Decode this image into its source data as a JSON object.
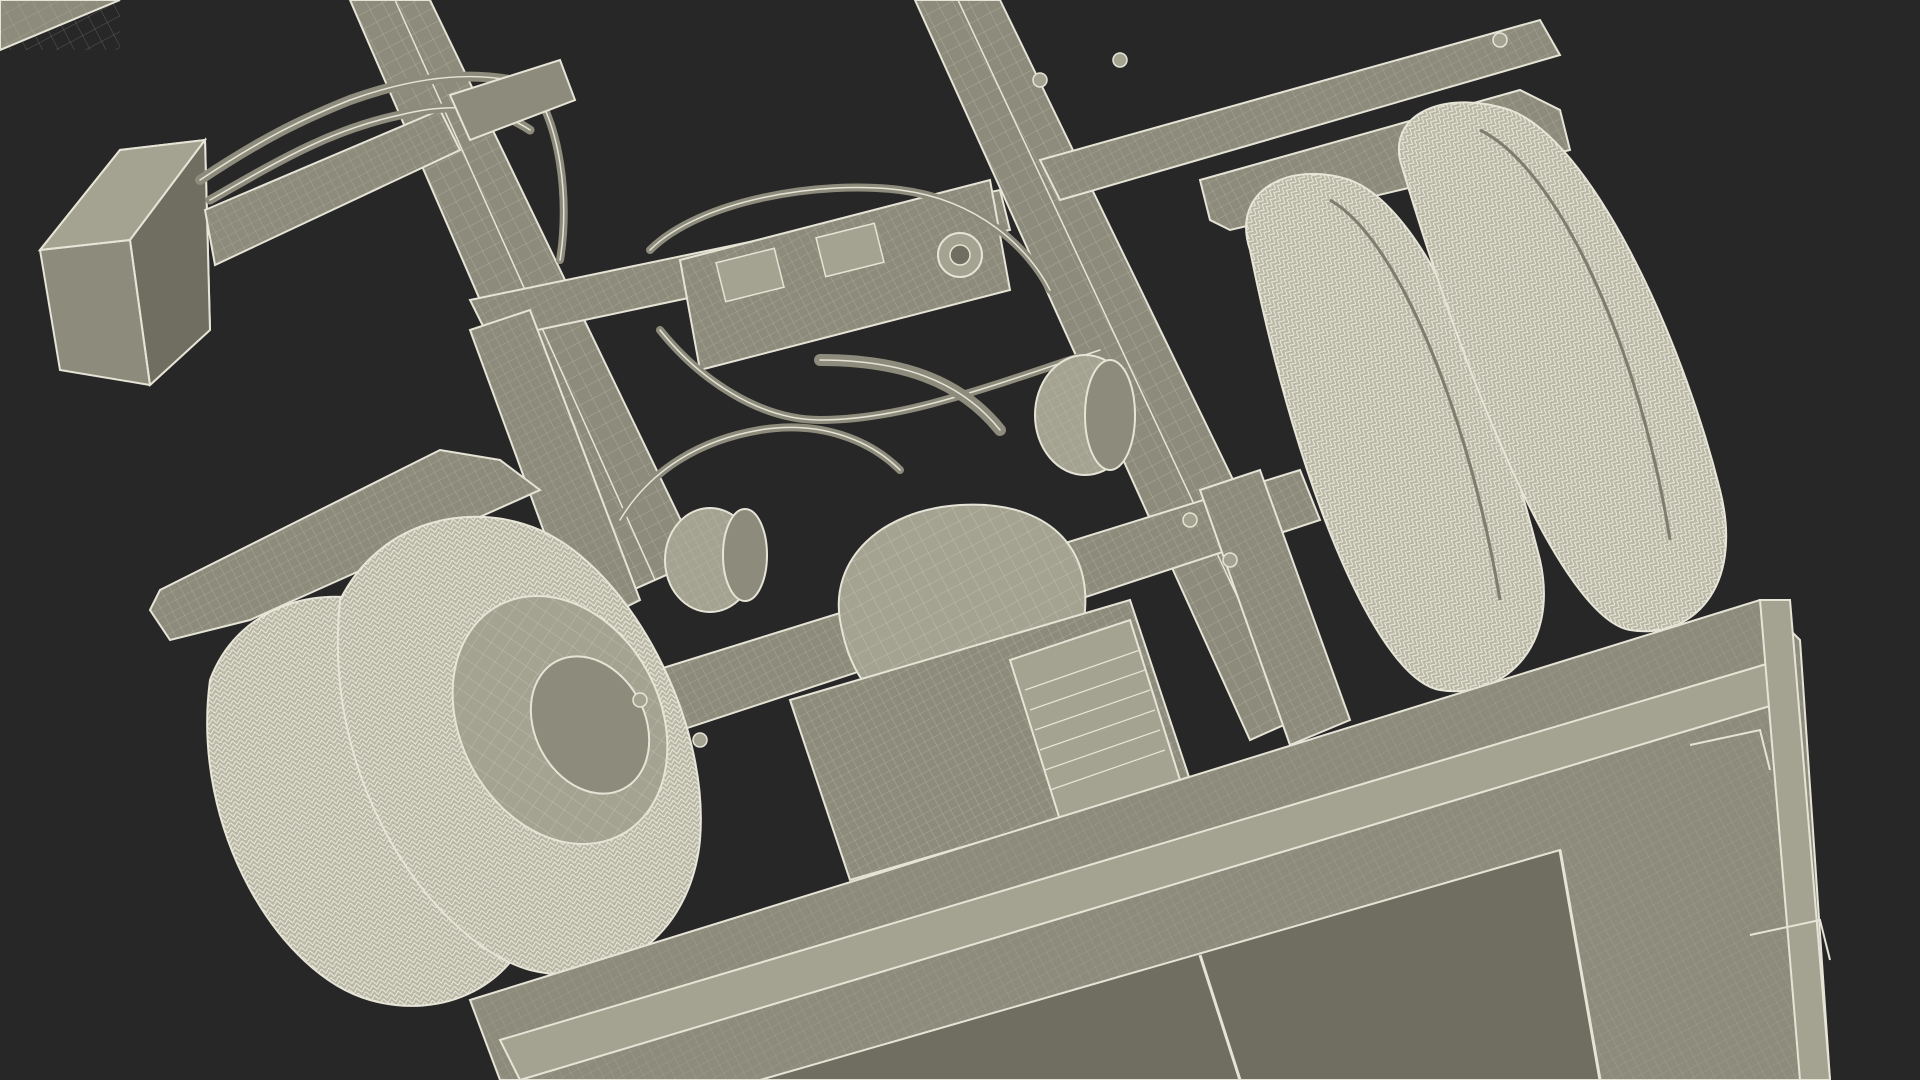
{
  "scene": {
    "subject": "wireframe-truck-chassis-underside",
    "colors": {
      "background": "#272727",
      "body_fill": "#8d8c7c",
      "body_fill_light": "#a4a392",
      "body_fill_dark": "#6f6e61",
      "wire": "#e6e4d6",
      "tire_fill": "#b9b7a6",
      "tire_dark": "#7d7c6e"
    }
  }
}
